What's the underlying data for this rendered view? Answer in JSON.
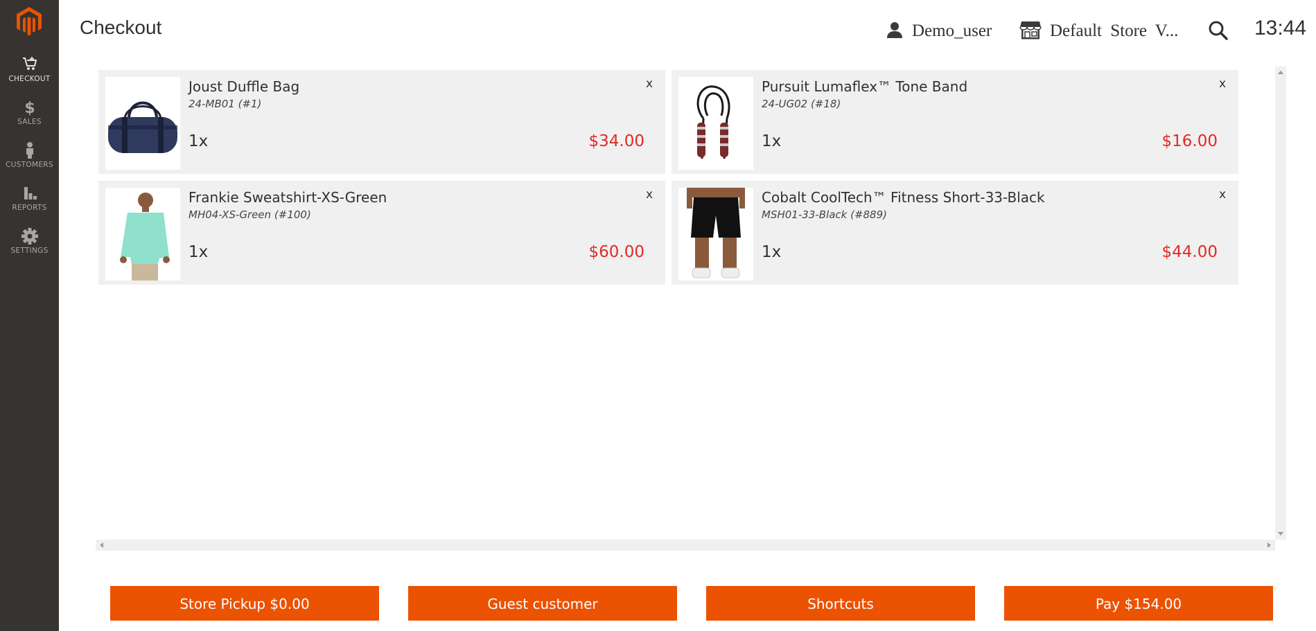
{
  "sidebar": {
    "logo": "magento-logo",
    "items": [
      {
        "label": "CHECKOUT",
        "icon": "cart-icon"
      },
      {
        "label": "SALES",
        "icon": "dollar-icon"
      },
      {
        "label": "CUSTOMERS",
        "icon": "customer-icon"
      },
      {
        "label": "REPORTS",
        "icon": "bar-chart-icon"
      },
      {
        "label": "SETTINGS",
        "icon": "gear-icon"
      }
    ]
  },
  "header": {
    "title": "Checkout",
    "user": "Demo_user",
    "store": "Default Store V...",
    "clock": "13:44"
  },
  "cart": {
    "items": [
      {
        "name": "Joust Duffle Bag",
        "sku": "24-MB01 (#1)",
        "qty": "1x",
        "price": "$34.00",
        "remove": "x"
      },
      {
        "name": "Pursuit Lumaflex™ Tone Band",
        "sku": "24-UG02 (#18)",
        "qty": "1x",
        "price": "$16.00",
        "remove": "x"
      },
      {
        "name": "Frankie Sweatshirt-XS-Green",
        "sku": "MH04-XS-Green (#100)",
        "qty": "1x",
        "price": "$60.00",
        "remove": "x"
      },
      {
        "name": "Cobalt CoolTech™ Fitness Short-33-Black",
        "sku": "MSH01-33-Black (#889)",
        "qty": "1x",
        "price": "$44.00",
        "remove": "x"
      }
    ]
  },
  "footer": {
    "store_pickup": "Store Pickup $0.00",
    "guest_customer": "Guest customer",
    "shortcuts": "Shortcuts",
    "pay": "Pay $154.00"
  },
  "colors": {
    "sidebar_bg": "#373330",
    "accent": "#eb5202",
    "price": "#e02b27",
    "card_bg": "#f0f0f0"
  }
}
